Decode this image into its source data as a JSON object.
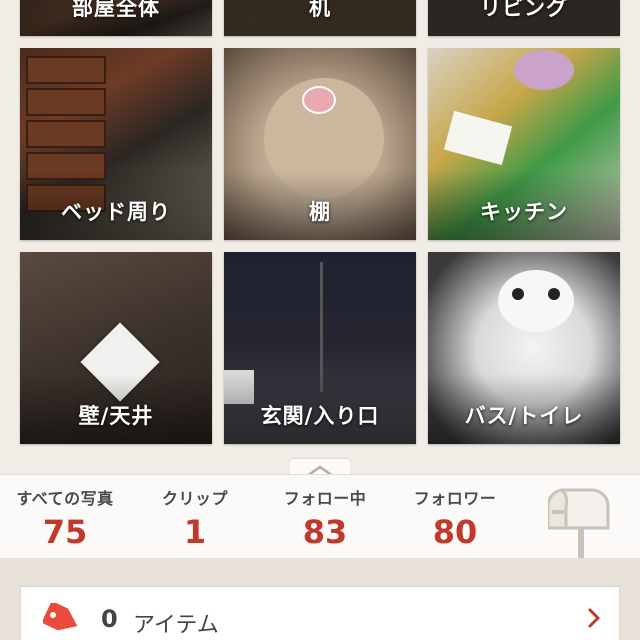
{
  "categories_top": [
    {
      "label": "部屋全体"
    },
    {
      "label": "机"
    },
    {
      "label": "リビング"
    }
  ],
  "categories": [
    {
      "label": "ベッド周り"
    },
    {
      "label": "棚"
    },
    {
      "label": "キッチン"
    },
    {
      "label": "壁/天井"
    },
    {
      "label": "玄関/入り口"
    },
    {
      "label": "バス/トイレ"
    }
  ],
  "stats": [
    {
      "label": "すべての写真",
      "value": "75"
    },
    {
      "label": "クリップ",
      "value": "1"
    },
    {
      "label": "フォロー中",
      "value": "83"
    },
    {
      "label": "フォロワー",
      "value": "80"
    }
  ],
  "items": {
    "count": "0",
    "label": "アイテム"
  },
  "icons": {
    "collapse": "chevron-up-icon",
    "mailbox": "mailbox-icon",
    "tag": "tag-icon",
    "arrow": "chevron-right-icon"
  },
  "colors": {
    "accent": "#c0392b",
    "tag": "#e74c3c",
    "background": "#efe9e3"
  }
}
